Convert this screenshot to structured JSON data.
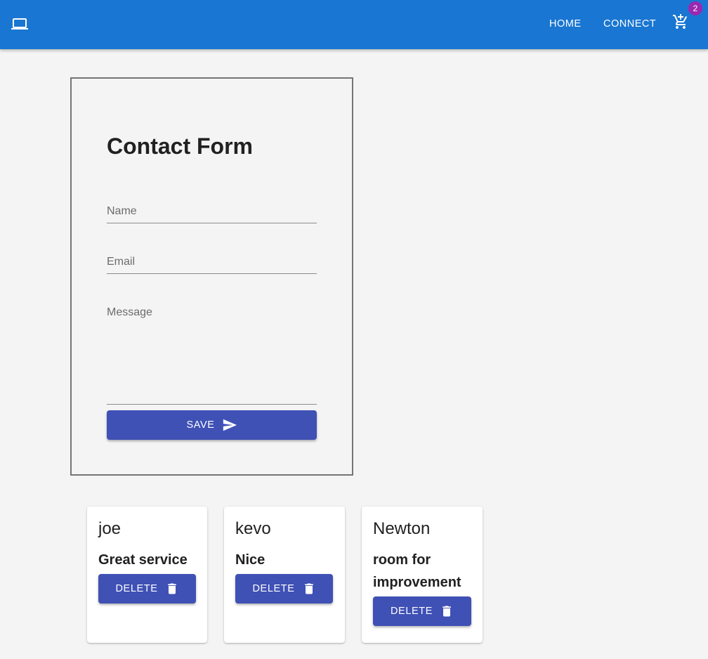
{
  "header": {
    "logo_icon": "laptop-icon",
    "nav": [
      {
        "label": "HOME"
      },
      {
        "label": "CONNECT"
      }
    ],
    "cart_icon": "add-shopping-cart-icon",
    "cart_badge": "2",
    "bar_color": "#1976d2",
    "badge_color": "#9c27b0"
  },
  "form": {
    "title": "Contact Form",
    "name_label": "Name",
    "email_label": "Email",
    "message_label": "Message",
    "save_label": "SAVE",
    "save_icon": "send-icon",
    "button_color": "#3f51b5"
  },
  "cards": [
    {
      "name": "joe",
      "message": "Great service",
      "delete_label": "DELETE",
      "delete_icon": "trash-icon"
    },
    {
      "name": "kevo",
      "message": "Nice",
      "delete_label": "DELETE",
      "delete_icon": "trash-icon"
    },
    {
      "name": "Newton",
      "message": "room for improvement",
      "delete_label": "DELETE",
      "delete_icon": "trash-icon"
    }
  ]
}
